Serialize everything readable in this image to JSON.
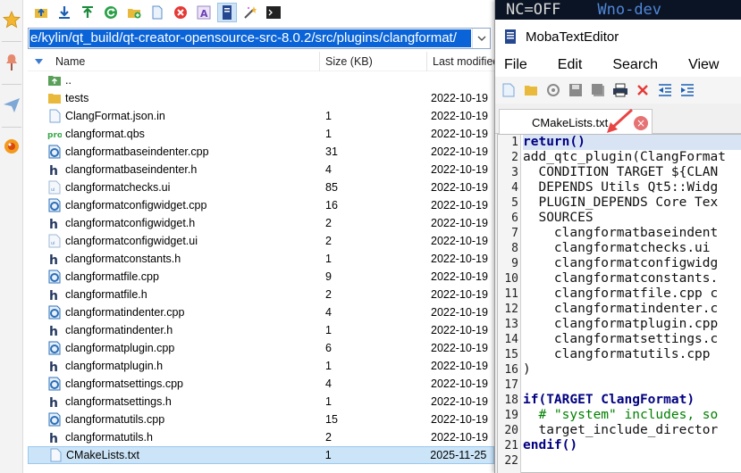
{
  "left_strip": {
    "icons": [
      "star-icon",
      "pin-icon",
      "paper-plane-icon",
      "bug-icon"
    ]
  },
  "browser": {
    "toolbar_icons": [
      "parent-dir-icon",
      "download-icon",
      "upload-icon",
      "refresh-icon",
      "new-folder-icon",
      "new-file-icon",
      "delete-icon",
      "rename-icon",
      "open-editor-icon",
      "magic-wand-icon",
      "terminal-icon"
    ],
    "path": "e/kylin/qt_build/qt-creator-opensource-src-8.0.2/src/plugins/clangformat/",
    "columns": {
      "name": "Name",
      "size": "Size (KB)",
      "date": "Last modified"
    },
    "rows": [
      {
        "icon": "parent-folder-icon",
        "name": "..",
        "size": "",
        "date": ""
      },
      {
        "icon": "folder-icon",
        "name": "tests",
        "size": "",
        "date": "2022-10-19"
      },
      {
        "icon": "file-icon",
        "name": "ClangFormat.json.in",
        "size": "1",
        "date": "2022-10-19"
      },
      {
        "icon": "qbs-icon",
        "name": "clangformat.qbs",
        "size": "1",
        "date": "2022-10-19"
      },
      {
        "icon": "cpp-icon",
        "name": "clangformatbaseindenter.cpp",
        "size": "31",
        "date": "2022-10-19"
      },
      {
        "icon": "header-icon",
        "name": "clangformatbaseindenter.h",
        "size": "4",
        "date": "2022-10-19"
      },
      {
        "icon": "ui-icon",
        "name": "clangformatchecks.ui",
        "size": "85",
        "date": "2022-10-19"
      },
      {
        "icon": "cpp-icon",
        "name": "clangformatconfigwidget.cpp",
        "size": "16",
        "date": "2022-10-19"
      },
      {
        "icon": "header-icon",
        "name": "clangformatconfigwidget.h",
        "size": "2",
        "date": "2022-10-19"
      },
      {
        "icon": "ui-icon",
        "name": "clangformatconfigwidget.ui",
        "size": "2",
        "date": "2022-10-19"
      },
      {
        "icon": "header-icon",
        "name": "clangformatconstants.h",
        "size": "1",
        "date": "2022-10-19"
      },
      {
        "icon": "cpp-icon",
        "name": "clangformatfile.cpp",
        "size": "9",
        "date": "2022-10-19"
      },
      {
        "icon": "header-icon",
        "name": "clangformatfile.h",
        "size": "2",
        "date": "2022-10-19"
      },
      {
        "icon": "cpp-icon",
        "name": "clangformatindenter.cpp",
        "size": "4",
        "date": "2022-10-19"
      },
      {
        "icon": "header-icon",
        "name": "clangformatindenter.h",
        "size": "1",
        "date": "2022-10-19"
      },
      {
        "icon": "cpp-icon",
        "name": "clangformatplugin.cpp",
        "size": "6",
        "date": "2022-10-19"
      },
      {
        "icon": "header-icon",
        "name": "clangformatplugin.h",
        "size": "1",
        "date": "2022-10-19"
      },
      {
        "icon": "cpp-icon",
        "name": "clangformatsettings.cpp",
        "size": "4",
        "date": "2022-10-19"
      },
      {
        "icon": "header-icon",
        "name": "clangformatsettings.h",
        "size": "1",
        "date": "2022-10-19"
      },
      {
        "icon": "cpp-icon",
        "name": "clangformatutils.cpp",
        "size": "15",
        "date": "2022-10-19"
      },
      {
        "icon": "header-icon",
        "name": "clangformatutils.h",
        "size": "2",
        "date": "2022-10-19"
      },
      {
        "icon": "file-icon",
        "name": "CMakeLists.txt",
        "size": "1",
        "date": "2025-11-25",
        "selected": true
      }
    ]
  },
  "editor": {
    "background_terminal_text": "NC=OFF",
    "background_terminal_text2": "Wno-dev",
    "title": "MobaTextEditor",
    "menus": [
      "File",
      "Edit",
      "Search",
      "View"
    ],
    "toolbar_icons": [
      "new-icon",
      "open-icon",
      "reload-icon",
      "save-icon",
      "save-all-icon",
      "print-icon",
      "close-icon",
      "outdent-icon",
      "indent-icon"
    ],
    "tab_label": "CMakeLists.txt",
    "line_numbers": [
      "1",
      "2",
      "3",
      "4",
      "5",
      "6",
      "7",
      "8",
      "9",
      "10",
      "11",
      "12",
      "13",
      "14",
      "15",
      "16",
      "17",
      "18",
      "19",
      "20",
      "21",
      "22"
    ],
    "lines": [
      "return()",
      "add_qtc_plugin(ClangFormat",
      "  CONDITION TARGET ${CLAN",
      "  DEPENDS Utils Qt5::Widg",
      "  PLUGIN_DEPENDS Core Tex",
      "  SOURCES",
      "    clangformatbaseindent",
      "    clangformatchecks.ui",
      "    clangformatconfigwidg",
      "    clangformatconstants.",
      "    clangformatfile.cpp c",
      "    clangformatindenter.c",
      "    clangformatplugin.cpp",
      "    clangformatsettings.c",
      "    clangformatutils.cpp ",
      ")",
      "",
      "if(TARGET ClangFormat)",
      "  # \"system\" includes, so",
      "  target_include_director",
      "endif()",
      ""
    ]
  },
  "colors": {
    "selection": "#0a64d8",
    "row_selected": "#cce4f7",
    "editor_keyword": "#000080",
    "editor_comment": "#008000"
  }
}
